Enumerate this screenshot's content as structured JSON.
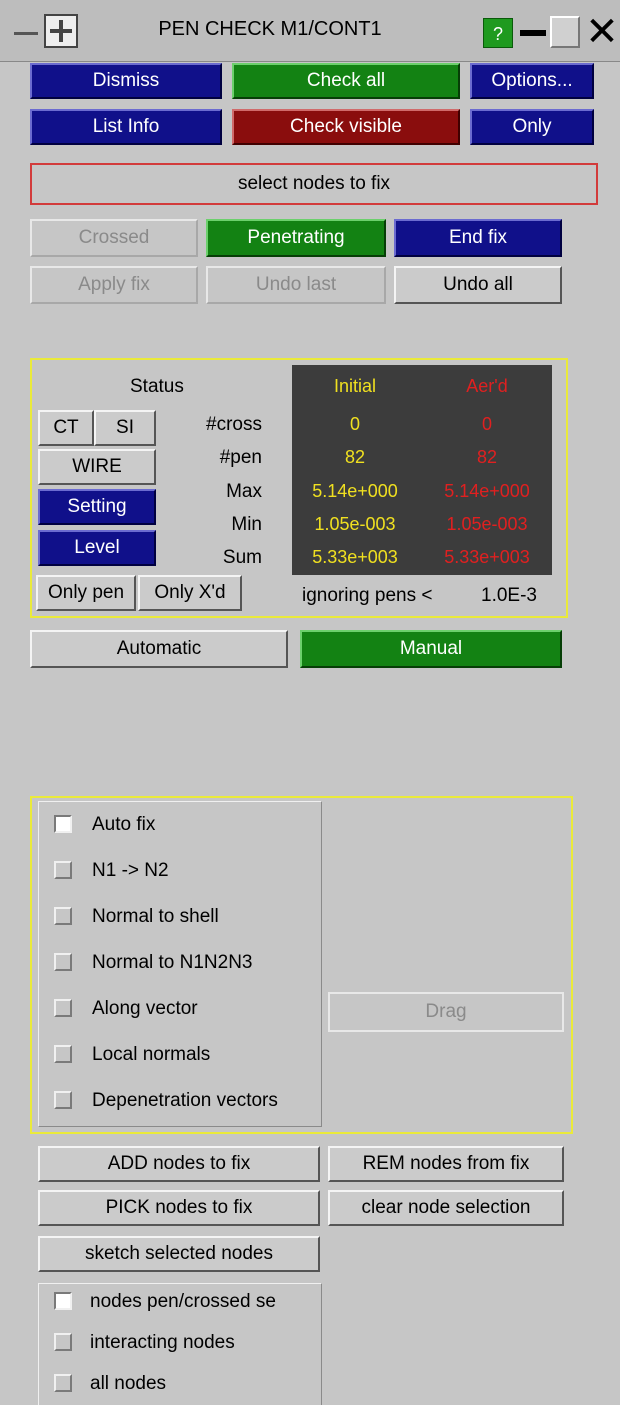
{
  "window": {
    "title": "PEN CHECK M1/CONT1",
    "help": "?"
  },
  "top_buttons": {
    "dismiss": "Dismiss",
    "check_all": "Check all",
    "options": "Options...",
    "list_info": "List Info",
    "check_visible": "Check visible",
    "only": "Only"
  },
  "message": "select nodes to fix",
  "fix_buttons": {
    "crossed": "Crossed",
    "penetrating": "Penetrating",
    "end_fix": "End fix",
    "apply_fix": "Apply fix",
    "undo_last": "Undo last",
    "undo_all": "Undo all"
  },
  "status": {
    "label": "Status",
    "ct": "CT",
    "si": "SI",
    "wire": "WIRE",
    "setting": "Setting",
    "level": "Level",
    "only_pen": "Only pen",
    "only_xd": "Only X'd",
    "rows": [
      "#cross",
      "#pen",
      "Max",
      "Min",
      "Sum"
    ],
    "initial_header": "Initial",
    "after_header": "Aer'd",
    "initial": [
      "0",
      "82",
      "5.14e+000",
      "1.05e-003",
      "5.33e+003"
    ],
    "after": [
      "0",
      "82",
      "5.14e+000",
      "1.05e-003",
      "5.33e+003"
    ],
    "ignoring_label": "ignoring pens <",
    "ignoring_value": "1.0E-3"
  },
  "mode": {
    "automatic": "Automatic",
    "manual": "Manual"
  },
  "options": [
    {
      "label": "Auto fix",
      "checked": true
    },
    {
      "label": "N1 -> N2",
      "checked": false
    },
    {
      "label": "Normal to shell",
      "checked": false
    },
    {
      "label": "Normal to N1N2N3",
      "checked": false
    },
    {
      "label": "Along vector",
      "checked": false
    },
    {
      "label": "Local normals",
      "checked": false
    },
    {
      "label": "Depenetration vectors",
      "checked": false
    }
  ],
  "drag": "Drag",
  "node_buttons": {
    "add": "ADD nodes to fix",
    "rem": "REM nodes from fix",
    "pick": "PICK nodes to fix",
    "clear": "clear node selection",
    "sketch": "sketch selected nodes"
  },
  "display_options": [
    {
      "label": "nodes pen/crossed se",
      "checked": true
    },
    {
      "label": "interacting nodes",
      "checked": false
    },
    {
      "label": "all nodes",
      "checked": false
    }
  ]
}
